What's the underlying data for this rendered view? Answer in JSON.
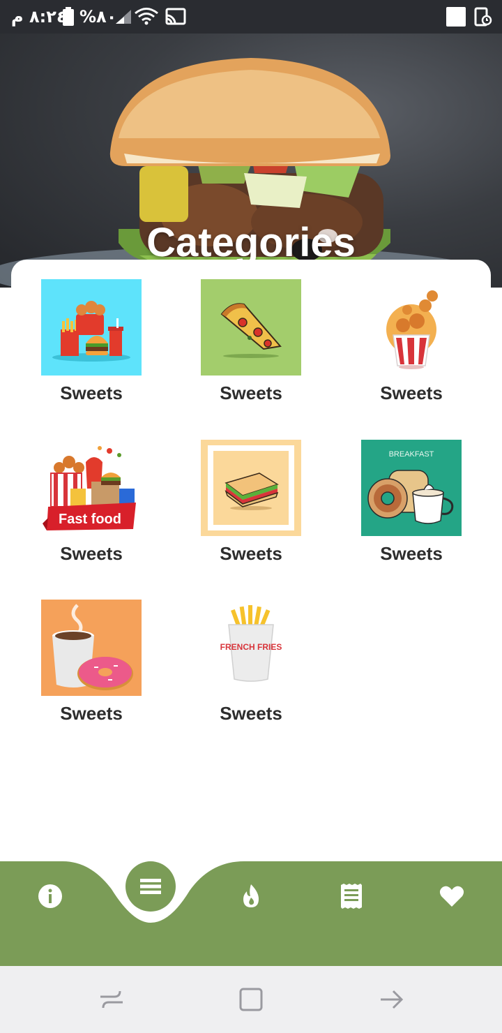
{
  "status_bar": {
    "time": "٨:٢٤ م",
    "battery": "%٨٠",
    "icons": [
      "battery-icon",
      "signal-icon",
      "wifi-icon",
      "cast-icon",
      "notification-square-icon",
      "screen-time-icon"
    ]
  },
  "hero": {
    "title": "Categories",
    "image": "burger-photo"
  },
  "categories": [
    {
      "label": "Sweets",
      "icon": "fast-food-meal-icon"
    },
    {
      "label": "Sweets",
      "icon": "pizza-slice-icon"
    },
    {
      "label": "Sweets",
      "icon": "fried-chicken-bucket-icon"
    },
    {
      "label": "Sweets",
      "icon": "fast-food-banner-icon",
      "image_text": "Fast food"
    },
    {
      "label": "Sweets",
      "icon": "sandwich-icon"
    },
    {
      "label": "Sweets",
      "icon": "breakfast-donut-coffee-icon",
      "image_text": "BREAKFAST"
    },
    {
      "label": "Sweets",
      "icon": "coffee-donut-icon"
    },
    {
      "label": "Sweets",
      "icon": "french-fries-icon",
      "image_text": "FRENCH FRIES"
    }
  ],
  "bottom_nav": {
    "items": [
      "info-icon",
      "menu-icon",
      "fire-icon",
      "receipt-icon",
      "heart-icon"
    ],
    "active": "menu-icon",
    "color": "#7b9c57"
  },
  "system_nav": [
    "recent-apps-icon",
    "home-icon",
    "back-icon"
  ]
}
